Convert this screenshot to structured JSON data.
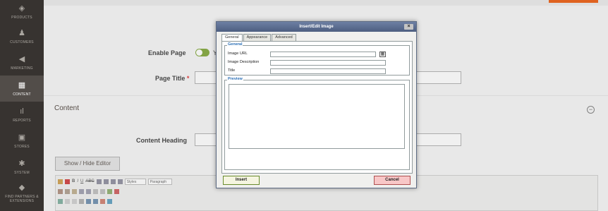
{
  "sidebar": {
    "items": [
      {
        "label": "PRODUCTS",
        "icon": "cube-icon",
        "glyph": "◈"
      },
      {
        "label": "CUSTOMERS",
        "icon": "person-icon",
        "glyph": "♟"
      },
      {
        "label": "MARKETING",
        "icon": "megaphone-icon",
        "glyph": "◀"
      },
      {
        "label": "CONTENT",
        "icon": "layout-icon",
        "glyph": "▦"
      },
      {
        "label": "REPORTS",
        "icon": "bar-chart-icon",
        "glyph": "ıl"
      },
      {
        "label": "STORES",
        "icon": "store-icon",
        "glyph": "▣"
      },
      {
        "label": "SYSTEM",
        "icon": "gear-icon",
        "glyph": "✱"
      },
      {
        "label": "FIND PARTNERS & EXTENSIONS",
        "icon": "box-icon",
        "glyph": "◆"
      }
    ]
  },
  "form": {
    "enable_page_label": "Enable Page",
    "enable_page_value": "Y",
    "page_title_label": "Page Title",
    "page_title_required": "*",
    "content_section_title": "Content",
    "collapse_symbol": "−",
    "content_heading_label": "Content Heading",
    "show_hide_editor_label": "Show / Hide Editor"
  },
  "editor_toolbar": {
    "row1": [
      "B",
      "I",
      "U",
      "ABC"
    ],
    "styles_select": "Styles",
    "paragraph_select": "Paragraph"
  },
  "dialog": {
    "title": "Insert/Edit Image",
    "close_symbol": "×",
    "tabs": [
      {
        "label": "General",
        "active": true
      },
      {
        "label": "Appearance",
        "active": false
      },
      {
        "label": "Advanced",
        "active": false
      }
    ],
    "general_legend": "General",
    "fields": {
      "image_url_label": "Image URL",
      "image_description_label": "Image Description",
      "title_label": "Title"
    },
    "browse_icon_glyph": "▦",
    "preview_legend": "Preview",
    "insert_label": "Insert",
    "cancel_label": "Cancel"
  },
  "colors": {
    "sidebar_bg": "#373330",
    "toggle_on": "#79a22e",
    "accent": "#eb5202",
    "dialog_title": "#5d6b84"
  }
}
